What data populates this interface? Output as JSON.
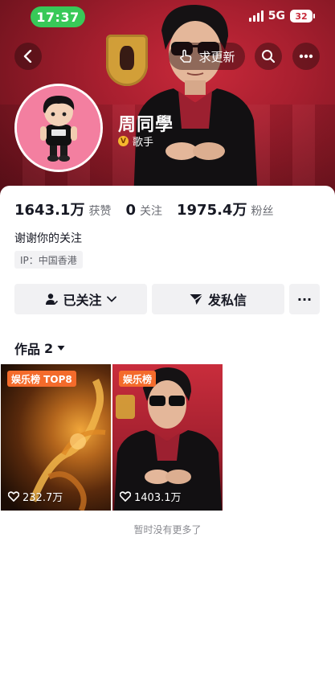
{
  "status_bar": {
    "time": "17:37",
    "network": "5G",
    "battery": "32"
  },
  "header": {
    "update_label": "求更新",
    "name": "周同學",
    "verified_title": "歌手",
    "verified_badge": "V"
  },
  "stats": [
    {
      "value": "1643.1万",
      "label": "获赞"
    },
    {
      "value": "0",
      "label": "关注"
    },
    {
      "value": "1975.4万",
      "label": "粉丝"
    }
  ],
  "signature": "谢谢你的关注",
  "ip_label": "IP：中国香港",
  "actions": {
    "follow_label": "已关注",
    "message_label": "发私信",
    "more_label": "···"
  },
  "works": {
    "tab_label": "作品",
    "count": "2",
    "videos": [
      {
        "tag": "娱乐榜 TOP8",
        "likes": "232.7万"
      },
      {
        "tag": "娱乐榜",
        "likes": "1403.1万"
      }
    ],
    "footer": "暂时没有更多了"
  },
  "colors": {
    "banner_red": "#a81f2f",
    "status_green": "#38c958",
    "tag_orange": "#f46b2b",
    "verified_gold": "#f5b82e"
  }
}
